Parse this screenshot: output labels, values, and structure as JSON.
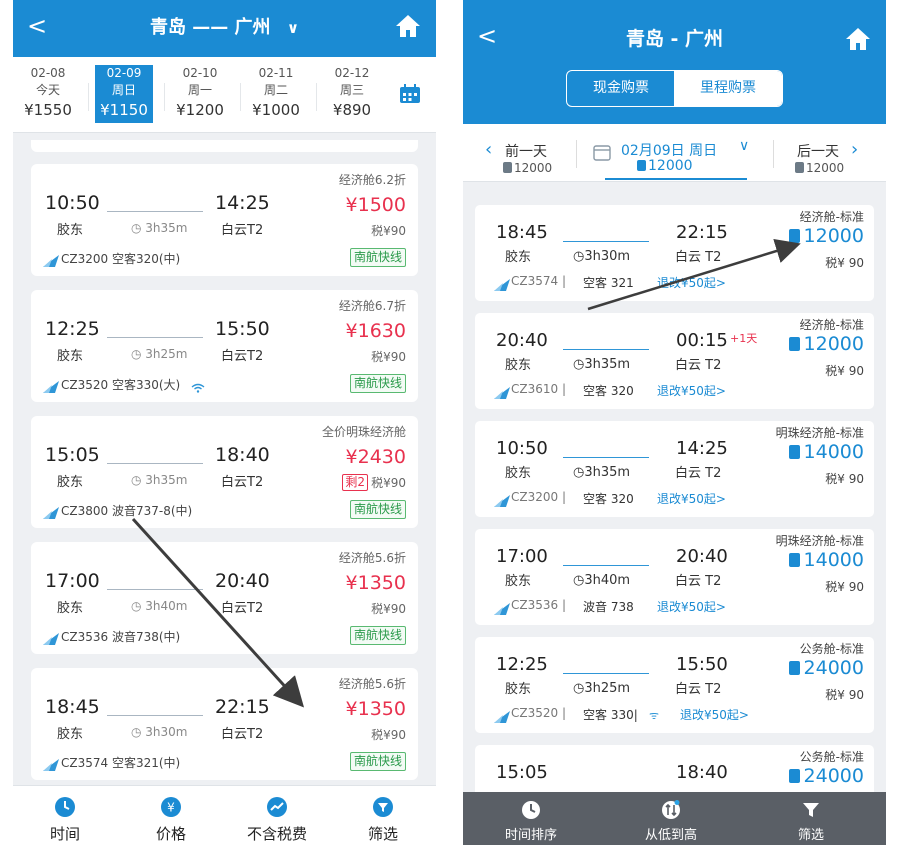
{
  "left": {
    "header": {
      "back": "<",
      "title": "青岛 —— 广州",
      "dropdown": "∨"
    },
    "dates": [
      {
        "date": "02-08",
        "day": "今天",
        "price": "¥1550"
      },
      {
        "date": "02-09",
        "day": "周日",
        "price": "¥1150"
      },
      {
        "date": "02-10",
        "day": "周一",
        "price": "¥1200"
      },
      {
        "date": "02-11",
        "day": "周二",
        "price": "¥1000"
      },
      {
        "date": "02-12",
        "day": "周三",
        "price": "¥890"
      }
    ],
    "selected_date_index": 1,
    "flights": [
      {
        "dep": "10:50",
        "arr": "14:25",
        "from": "胶东",
        "to": "白云T2",
        "dur": "3h35m",
        "cabin": "经济舱6.2折",
        "price": "¥1500",
        "tax": "税¥90",
        "flight": "CZ3200 空客320(中)",
        "tag": "南航快线"
      },
      {
        "dep": "12:25",
        "arr": "15:50",
        "from": "胶东",
        "to": "白云T2",
        "dur": "3h25m",
        "cabin": "经济舱6.7折",
        "price": "¥1630",
        "tax": "税¥90",
        "flight": "CZ3520 空客330(大)",
        "tag": "南航快线"
      },
      {
        "dep": "15:05",
        "arr": "18:40",
        "from": "胶东",
        "to": "白云T2",
        "dur": "3h35m",
        "cabin": "全价明珠经济舱",
        "price": "¥2430",
        "remain": "剩2",
        "tax": "税¥90",
        "flight": "CZ3800 波音737-8(中)",
        "tag": "南航快线"
      },
      {
        "dep": "17:00",
        "arr": "20:40",
        "from": "胶东",
        "to": "白云T2",
        "dur": "3h40m",
        "cabin": "经济舱5.6折",
        "price": "¥1350",
        "tax": "税¥90",
        "flight": "CZ3536 波音738(中)",
        "tag": "南航快线"
      },
      {
        "dep": "18:45",
        "arr": "22:15",
        "from": "胶东",
        "to": "白云T2",
        "dur": "3h30m",
        "cabin": "经济舱5.6折",
        "price": "¥1350",
        "tax": "税¥90",
        "flight": "CZ3574 空客321(中)",
        "tag": "南航快线"
      }
    ],
    "bottom": [
      {
        "label": "时间",
        "icon": "clock-icon"
      },
      {
        "label": "价格",
        "icon": "yen-icon"
      },
      {
        "label": "不含税费",
        "icon": "trend-icon"
      },
      {
        "label": "筛选",
        "icon": "filter-icon"
      }
    ]
  },
  "right": {
    "header": {
      "back": "<",
      "title": "青岛 - 广州"
    },
    "tabs": {
      "cash": "现金购票",
      "miles": "里程购票"
    },
    "daybar": {
      "prev": "前一天",
      "prev_miles": "12000",
      "cur": "02月09日 周日",
      "cur_miles": "12000",
      "next": "后一天",
      "next_miles": "12000"
    },
    "flights": [
      {
        "dep": "18:45",
        "arr": "22:15",
        "from": "胶东",
        "to": "白云 T2",
        "dur": "3h30m",
        "cabin": "经济舱-标准",
        "miles": "12000",
        "tax": "税¥ 90",
        "flight": "CZ3574 |",
        "type": "空客 321",
        "change": "退改¥50起>"
      },
      {
        "dep": "20:40",
        "arr": "00:15",
        "plus": "+1天",
        "from": "胶东",
        "to": "白云 T2",
        "dur": "3h35m",
        "cabin": "经济舱-标准",
        "miles": "12000",
        "tax": "税¥ 90",
        "flight": "CZ3610 |",
        "type": "空客 320",
        "change": "退改¥50起>"
      },
      {
        "dep": "10:50",
        "arr": "14:25",
        "from": "胶东",
        "to": "白云 T2",
        "dur": "3h35m",
        "cabin": "明珠经济舱-标准",
        "miles": "14000",
        "tax": "税¥ 90",
        "flight": "CZ3200 |",
        "type": "空客 320",
        "change": "退改¥50起>"
      },
      {
        "dep": "17:00",
        "arr": "20:40",
        "from": "胶东",
        "to": "白云 T2",
        "dur": "3h40m",
        "cabin": "明珠经济舱-标准",
        "miles": "14000",
        "tax": "税¥ 90",
        "flight": "CZ3536 |",
        "type": "波音 738",
        "change": "退改¥50起>"
      },
      {
        "dep": "12:25",
        "arr": "15:50",
        "from": "胶东",
        "to": "白云 T2",
        "dur": "3h25m",
        "cabin": "公务舱-标准",
        "miles": "24000",
        "tax": "税¥ 90",
        "flight": "CZ3520 |",
        "type": "空客 330|",
        "change": "退改¥50起>"
      },
      {
        "dep": "15:05",
        "arr": "18:40",
        "from": "",
        "to": "",
        "dur": "",
        "cabin": "公务舱-标准",
        "miles": "24000",
        "tax": "",
        "flight": "",
        "type": "",
        "change": ""
      }
    ],
    "bottom": [
      {
        "label": "时间排序",
        "icon": "clock-icon"
      },
      {
        "label": "从低到高",
        "icon": "sort-icon"
      },
      {
        "label": "筛选",
        "icon": "filter-icon"
      }
    ]
  },
  "colors": {
    "brand": "#1b8bd3",
    "price": "#e8314e",
    "tag": "#2a9a4a",
    "bottom_dark": "#5a5f66"
  }
}
